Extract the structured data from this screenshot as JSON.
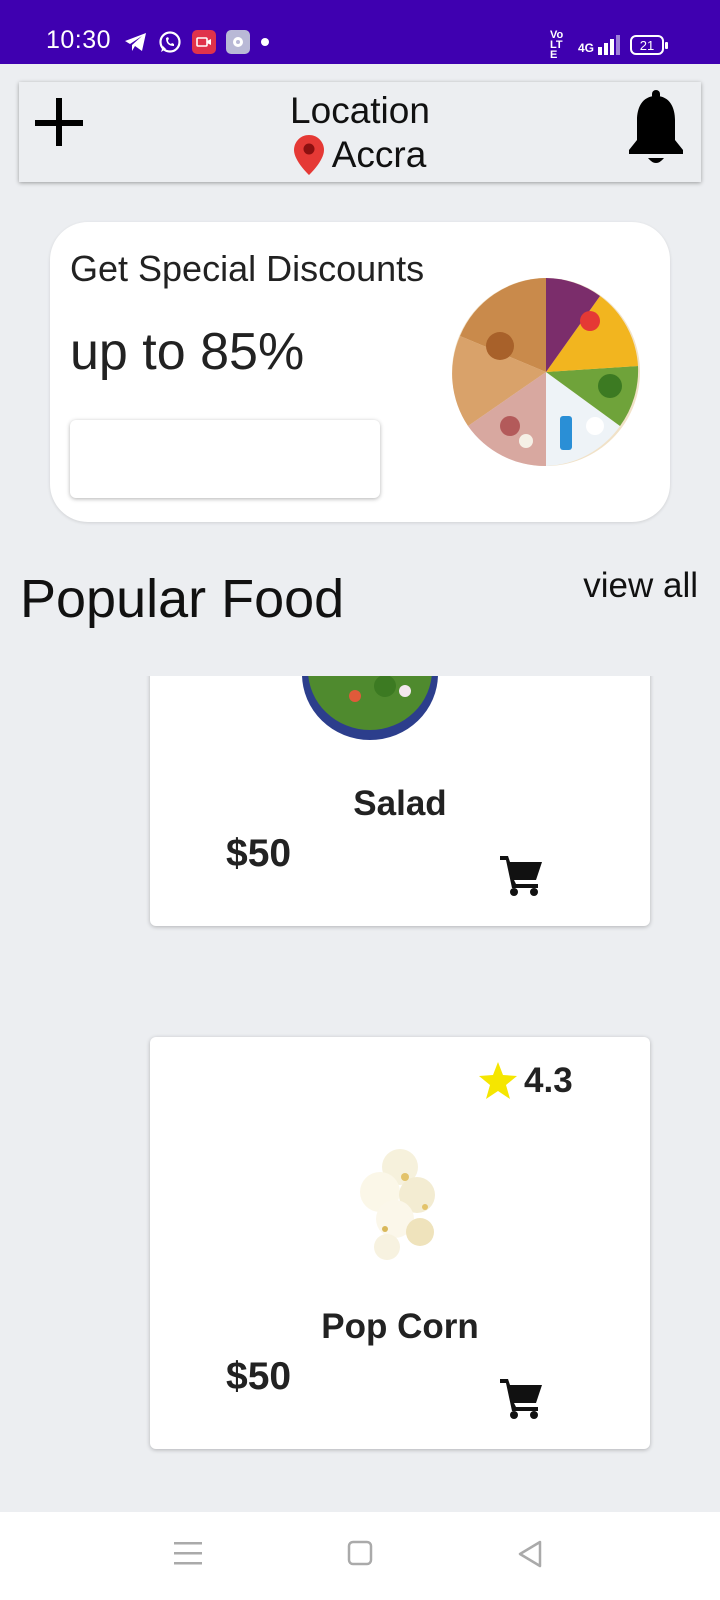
{
  "status_bar": {
    "time": "10:30",
    "network_tag": "Vo LTE",
    "network_gen": "4G",
    "battery_level": "21"
  },
  "header": {
    "location_title": "Location",
    "city": "Accra",
    "icons": {
      "add": "plus-icon",
      "location": "location-pin-icon",
      "notifications": "bell-icon"
    },
    "pin_color": "#e53935"
  },
  "promo": {
    "title": "Get Special Discounts",
    "subtitle": "up to 85%",
    "image": "food-wheel-image"
  },
  "popular": {
    "title": "Popular Food",
    "view_all": "view all",
    "items": [
      {
        "name": "Salad",
        "price": "$50",
        "image": "salad-bowl-image",
        "cart_icon": "cart-icon"
      },
      {
        "name": "Pop Corn",
        "price": "$50",
        "rating": "4.3",
        "image": "popcorn-image",
        "cart_icon": "cart-icon",
        "star_color": "#f5e600"
      }
    ]
  },
  "nav_bar": {
    "items": [
      "menu-icon",
      "home-square-icon",
      "back-triangle-icon"
    ]
  },
  "colors": {
    "status_bar": "#3f00b0",
    "background": "#eceef1",
    "card": "#ffffff"
  }
}
